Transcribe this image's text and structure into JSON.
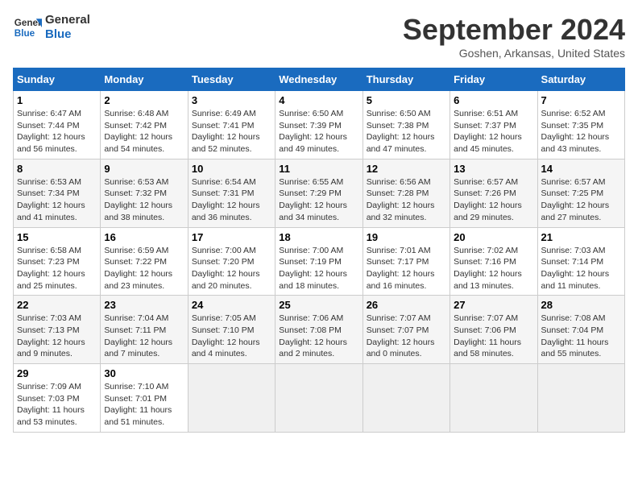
{
  "logo": {
    "line1": "General",
    "line2": "Blue"
  },
  "title": "September 2024",
  "location": "Goshen, Arkansas, United States",
  "days_of_week": [
    "Sunday",
    "Monday",
    "Tuesday",
    "Wednesday",
    "Thursday",
    "Friday",
    "Saturday"
  ],
  "weeks": [
    [
      {
        "day": "1",
        "info": "Sunrise: 6:47 AM\nSunset: 7:44 PM\nDaylight: 12 hours\nand 56 minutes."
      },
      {
        "day": "2",
        "info": "Sunrise: 6:48 AM\nSunset: 7:42 PM\nDaylight: 12 hours\nand 54 minutes."
      },
      {
        "day": "3",
        "info": "Sunrise: 6:49 AM\nSunset: 7:41 PM\nDaylight: 12 hours\nand 52 minutes."
      },
      {
        "day": "4",
        "info": "Sunrise: 6:50 AM\nSunset: 7:39 PM\nDaylight: 12 hours\nand 49 minutes."
      },
      {
        "day": "5",
        "info": "Sunrise: 6:50 AM\nSunset: 7:38 PM\nDaylight: 12 hours\nand 47 minutes."
      },
      {
        "day": "6",
        "info": "Sunrise: 6:51 AM\nSunset: 7:37 PM\nDaylight: 12 hours\nand 45 minutes."
      },
      {
        "day": "7",
        "info": "Sunrise: 6:52 AM\nSunset: 7:35 PM\nDaylight: 12 hours\nand 43 minutes."
      }
    ],
    [
      {
        "day": "8",
        "info": "Sunrise: 6:53 AM\nSunset: 7:34 PM\nDaylight: 12 hours\nand 41 minutes."
      },
      {
        "day": "9",
        "info": "Sunrise: 6:53 AM\nSunset: 7:32 PM\nDaylight: 12 hours\nand 38 minutes."
      },
      {
        "day": "10",
        "info": "Sunrise: 6:54 AM\nSunset: 7:31 PM\nDaylight: 12 hours\nand 36 minutes."
      },
      {
        "day": "11",
        "info": "Sunrise: 6:55 AM\nSunset: 7:29 PM\nDaylight: 12 hours\nand 34 minutes."
      },
      {
        "day": "12",
        "info": "Sunrise: 6:56 AM\nSunset: 7:28 PM\nDaylight: 12 hours\nand 32 minutes."
      },
      {
        "day": "13",
        "info": "Sunrise: 6:57 AM\nSunset: 7:26 PM\nDaylight: 12 hours\nand 29 minutes."
      },
      {
        "day": "14",
        "info": "Sunrise: 6:57 AM\nSunset: 7:25 PM\nDaylight: 12 hours\nand 27 minutes."
      }
    ],
    [
      {
        "day": "15",
        "info": "Sunrise: 6:58 AM\nSunset: 7:23 PM\nDaylight: 12 hours\nand 25 minutes."
      },
      {
        "day": "16",
        "info": "Sunrise: 6:59 AM\nSunset: 7:22 PM\nDaylight: 12 hours\nand 23 minutes."
      },
      {
        "day": "17",
        "info": "Sunrise: 7:00 AM\nSunset: 7:20 PM\nDaylight: 12 hours\nand 20 minutes."
      },
      {
        "day": "18",
        "info": "Sunrise: 7:00 AM\nSunset: 7:19 PM\nDaylight: 12 hours\nand 18 minutes."
      },
      {
        "day": "19",
        "info": "Sunrise: 7:01 AM\nSunset: 7:17 PM\nDaylight: 12 hours\nand 16 minutes."
      },
      {
        "day": "20",
        "info": "Sunrise: 7:02 AM\nSunset: 7:16 PM\nDaylight: 12 hours\nand 13 minutes."
      },
      {
        "day": "21",
        "info": "Sunrise: 7:03 AM\nSunset: 7:14 PM\nDaylight: 12 hours\nand 11 minutes."
      }
    ],
    [
      {
        "day": "22",
        "info": "Sunrise: 7:03 AM\nSunset: 7:13 PM\nDaylight: 12 hours\nand 9 minutes."
      },
      {
        "day": "23",
        "info": "Sunrise: 7:04 AM\nSunset: 7:11 PM\nDaylight: 12 hours\nand 7 minutes."
      },
      {
        "day": "24",
        "info": "Sunrise: 7:05 AM\nSunset: 7:10 PM\nDaylight: 12 hours\nand 4 minutes."
      },
      {
        "day": "25",
        "info": "Sunrise: 7:06 AM\nSunset: 7:08 PM\nDaylight: 12 hours\nand 2 minutes."
      },
      {
        "day": "26",
        "info": "Sunrise: 7:07 AM\nSunset: 7:07 PM\nDaylight: 12 hours\nand 0 minutes."
      },
      {
        "day": "27",
        "info": "Sunrise: 7:07 AM\nSunset: 7:06 PM\nDaylight: 11 hours\nand 58 minutes."
      },
      {
        "day": "28",
        "info": "Sunrise: 7:08 AM\nSunset: 7:04 PM\nDaylight: 11 hours\nand 55 minutes."
      }
    ],
    [
      {
        "day": "29",
        "info": "Sunrise: 7:09 AM\nSunset: 7:03 PM\nDaylight: 11 hours\nand 53 minutes."
      },
      {
        "day": "30",
        "info": "Sunrise: 7:10 AM\nSunset: 7:01 PM\nDaylight: 11 hours\nand 51 minutes."
      },
      {
        "day": "",
        "info": ""
      },
      {
        "day": "",
        "info": ""
      },
      {
        "day": "",
        "info": ""
      },
      {
        "day": "",
        "info": ""
      },
      {
        "day": "",
        "info": ""
      }
    ]
  ]
}
